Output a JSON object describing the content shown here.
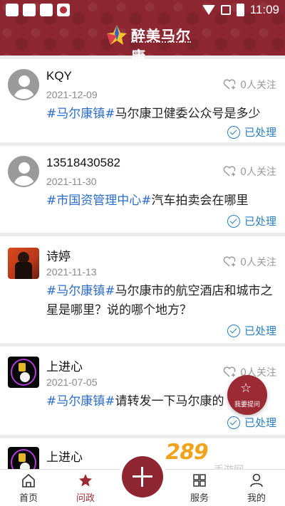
{
  "status_bar": {
    "time": "11:09"
  },
  "header": {
    "logo_title": "醉美马尔康"
  },
  "posts": [
    {
      "name": "KQY",
      "date": "2021-12-09",
      "follow": "0人关注",
      "tag": "#马尔康镇#",
      "question": "马尔康卫健委公众号是多少",
      "status": "已处理"
    },
    {
      "name": "13518430582",
      "date": "2021-11-30",
      "follow": "0人关注",
      "tag": "#市国资管理中心#",
      "question": "汽车拍卖会在哪里",
      "status": "已处理"
    },
    {
      "name": "诗婷",
      "date": "2021-11-13",
      "follow": "0人关注",
      "tag": "#马尔康镇#",
      "question": "马尔康市的航空酒店和城市之星是哪里？说的哪个地方？",
      "status": "已处理"
    },
    {
      "name": "上进心",
      "date": "2021-07-05",
      "follow": "0人关注",
      "tag": "#马尔康镇#",
      "question": "请转发一下马尔康的",
      "status": "已处理"
    },
    {
      "name": "上进心"
    }
  ],
  "fab": {
    "label": "我要提问"
  },
  "watermark": {
    "number": "289",
    "text": "手游网"
  },
  "nav": {
    "home": "首页",
    "politics": "问政",
    "services": "服务",
    "me": "我的"
  }
}
